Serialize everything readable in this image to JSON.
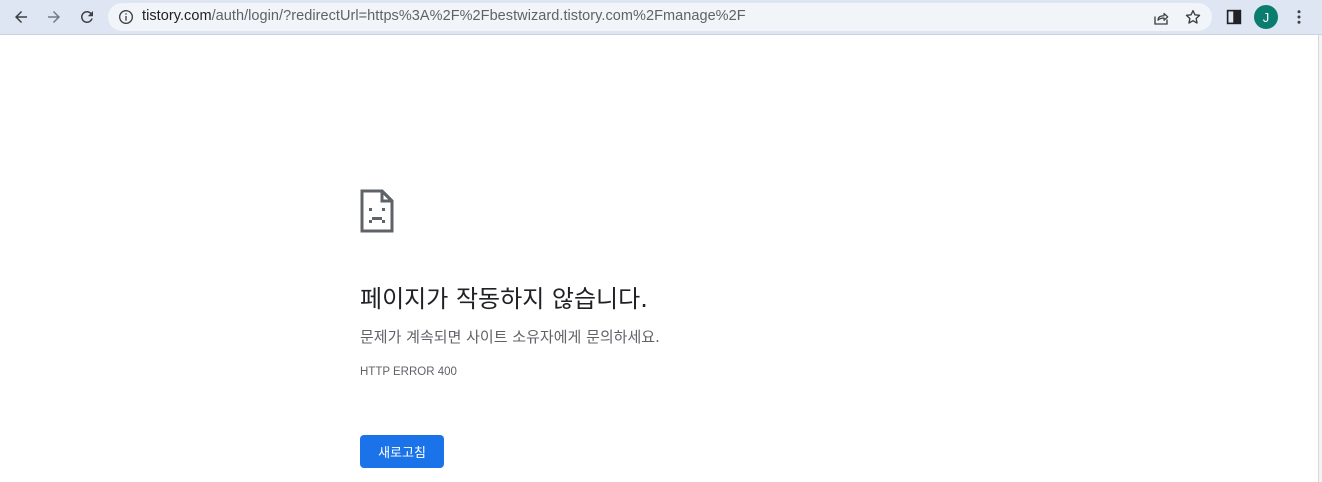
{
  "browser": {
    "url_host": "tistory.com",
    "url_path": "/auth/login/?redirectUrl=https%3A%2F%2Fbestwizard.tistory.com%2Fmanage%2F",
    "profile_initial": "J",
    "icons": {
      "back": "arrow-left-icon",
      "forward": "arrow-right-icon",
      "reload": "reload-icon",
      "site_info": "info-icon",
      "share": "share-icon",
      "bookmark": "star-icon",
      "side_panel": "side-panel-icon",
      "menu": "more-vert-icon"
    },
    "colors": {
      "toolbar_bg": "#dfe6f3",
      "omnibox_bg": "#f1f4f9",
      "avatar_bg": "#0b7d6e"
    }
  },
  "error_page": {
    "icon": "sad-page-icon",
    "title": "페이지가 작동하지 않습니다.",
    "description": "문제가 계속되면 사이트 소유자에게 문의하세요.",
    "error_code": "HTTP ERROR 400",
    "reload_label": "새로고침",
    "colors": {
      "button_bg": "#1a73e8",
      "title": "#202124",
      "secondary_text": "#5f6368"
    }
  }
}
